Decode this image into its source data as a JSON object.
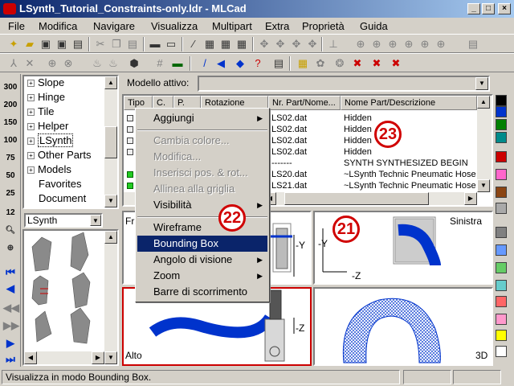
{
  "window": {
    "title": "LSynth_Tutorial_Constraints-only.ldr - MLCad",
    "min_label": "_",
    "max_label": "□",
    "close_label": "×"
  },
  "menu": [
    "File",
    "Modifica",
    "Navigare",
    "Visualizza",
    "Multipart",
    "Extra",
    "Proprietà",
    "Guida"
  ],
  "left_toolbar_zoom": [
    "300",
    "200",
    "150",
    "100",
    "75",
    "50",
    "25",
    "12"
  ],
  "tree": {
    "items": [
      "Slope",
      "Hinge",
      "Tile",
      "Helper",
      "LSynth",
      "Other Parts",
      "Models",
      "Favorites",
      "Document"
    ],
    "selected": "LSynth"
  },
  "palette": {
    "combo_value": "LSynth"
  },
  "model": {
    "label": "Modello attivo:",
    "value": ""
  },
  "parts_table": {
    "headers": [
      "Tipo",
      "C.",
      "P.",
      "Rotazione",
      "Nr. Part/Nome...",
      "Nome Part/Descrizione"
    ],
    "rows": [
      {
        "part": "LS02.dat",
        "desc": "Hidden"
      },
      {
        "part": "LS02.dat",
        "desc": "Hidden"
      },
      {
        "part": "LS02.dat",
        "desc": "Hidden"
      },
      {
        "part": "LS02.dat",
        "desc": "Hidden"
      },
      {
        "part": "-------",
        "desc": "SYNTH SYNTHESIZED BEGIN"
      },
      {
        "part": "LS20.dat",
        "desc": "~LSynth Technic Pneumatic Hose"
      },
      {
        "part": "LS21.dat",
        "desc": "~LSynth Technic Pneumatic Hose"
      }
    ]
  },
  "views": {
    "front": {
      "label": "Fr",
      "axis_y": "-Y",
      "axis_z": ""
    },
    "left": {
      "label": "Sinistra",
      "axis_y": "-Y",
      "axis_z": "-Z"
    },
    "top": {
      "label": "Alto",
      "axis_z": "-Z"
    },
    "3d": {
      "label": "3D"
    }
  },
  "context_menu": {
    "items": [
      {
        "label": "Aggiungi",
        "enabled": true,
        "submenu": true
      },
      {
        "label": "Cambia colore...",
        "enabled": false
      },
      {
        "label": "Modifica...",
        "enabled": false
      },
      {
        "label": "Inserisci pos. & rot...",
        "enabled": false
      },
      {
        "label": "Allinea alla griglia",
        "enabled": false
      },
      {
        "label": "Visibilità",
        "enabled": true,
        "submenu": true
      },
      {
        "label": "Wireframe",
        "enabled": true
      },
      {
        "label": "Bounding Box",
        "enabled": true,
        "highlighted": true
      },
      {
        "label": "Angolo di visione",
        "enabled": true,
        "submenu": true
      },
      {
        "label": "Zoom",
        "enabled": true,
        "submenu": true
      },
      {
        "label": "Barre di scorrimento",
        "enabled": true
      }
    ]
  },
  "callouts": [
    "23",
    "22",
    "21"
  ],
  "status": {
    "text": "Visualizza in modo Bounding Box."
  },
  "colors": {
    "accent": "#0a246a",
    "callout": "#d00000",
    "swatches": [
      "#000000",
      "#0033cc",
      "#008000",
      "#008b8b",
      "#cc0000",
      "#ff66cc",
      "#8b4513",
      "#a9a9a9",
      "#808080",
      "#6699ff",
      "#66cc66",
      "#66cccc",
      "#ff6666",
      "#ff99cc",
      "#ffff00",
      "#ffffff"
    ]
  }
}
